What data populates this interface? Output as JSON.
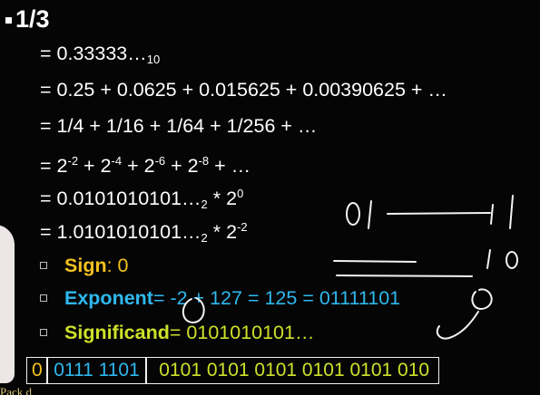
{
  "title": "1/3",
  "equations": {
    "l1_main": "= 0.33333…",
    "l1_sub": "10",
    "l2": "= 0.25 + 0.0625 + 0.015625 + 0.00390625 + …",
    "l3": "= 1/4 + 1/16 + 1/64 + 1/256 +  …",
    "l4_a": "= 2",
    "l4_e1": "-2",
    "l4_b": " + 2",
    "l4_e2": "-4",
    "l4_c": " + 2",
    "l4_e3": "-6",
    "l4_d": " + 2",
    "l4_e4": "-8",
    "l4_f": " + …",
    "l5_a": "= 0.0101010101…",
    "l5_sub": "2",
    "l5_b": " * 2",
    "l5_exp": "0",
    "l6_a": "= 1.0101010101…",
    "l6_sub": "2",
    "l6_b": " * 2",
    "l6_exp": "-2"
  },
  "fields": {
    "sign_label": "Sign",
    "sign_value": ": 0",
    "exponent_label": "Exponent",
    "exponent_value": " = -2 + 127 = 125 = 01111101",
    "significand_label": "Significand",
    "significand_value": " = 0101010101…"
  },
  "bit_fields": {
    "sign": "0",
    "exponent": "0111 1101",
    "fraction": "0101 0101 0101 0101 0101 010"
  },
  "colors": {
    "sign": "#f4c21e",
    "exponent": "#2fb8ee",
    "significand": "#cde12a",
    "text": "#ffffff",
    "background": "#050505"
  },
  "caption": "Pack d"
}
